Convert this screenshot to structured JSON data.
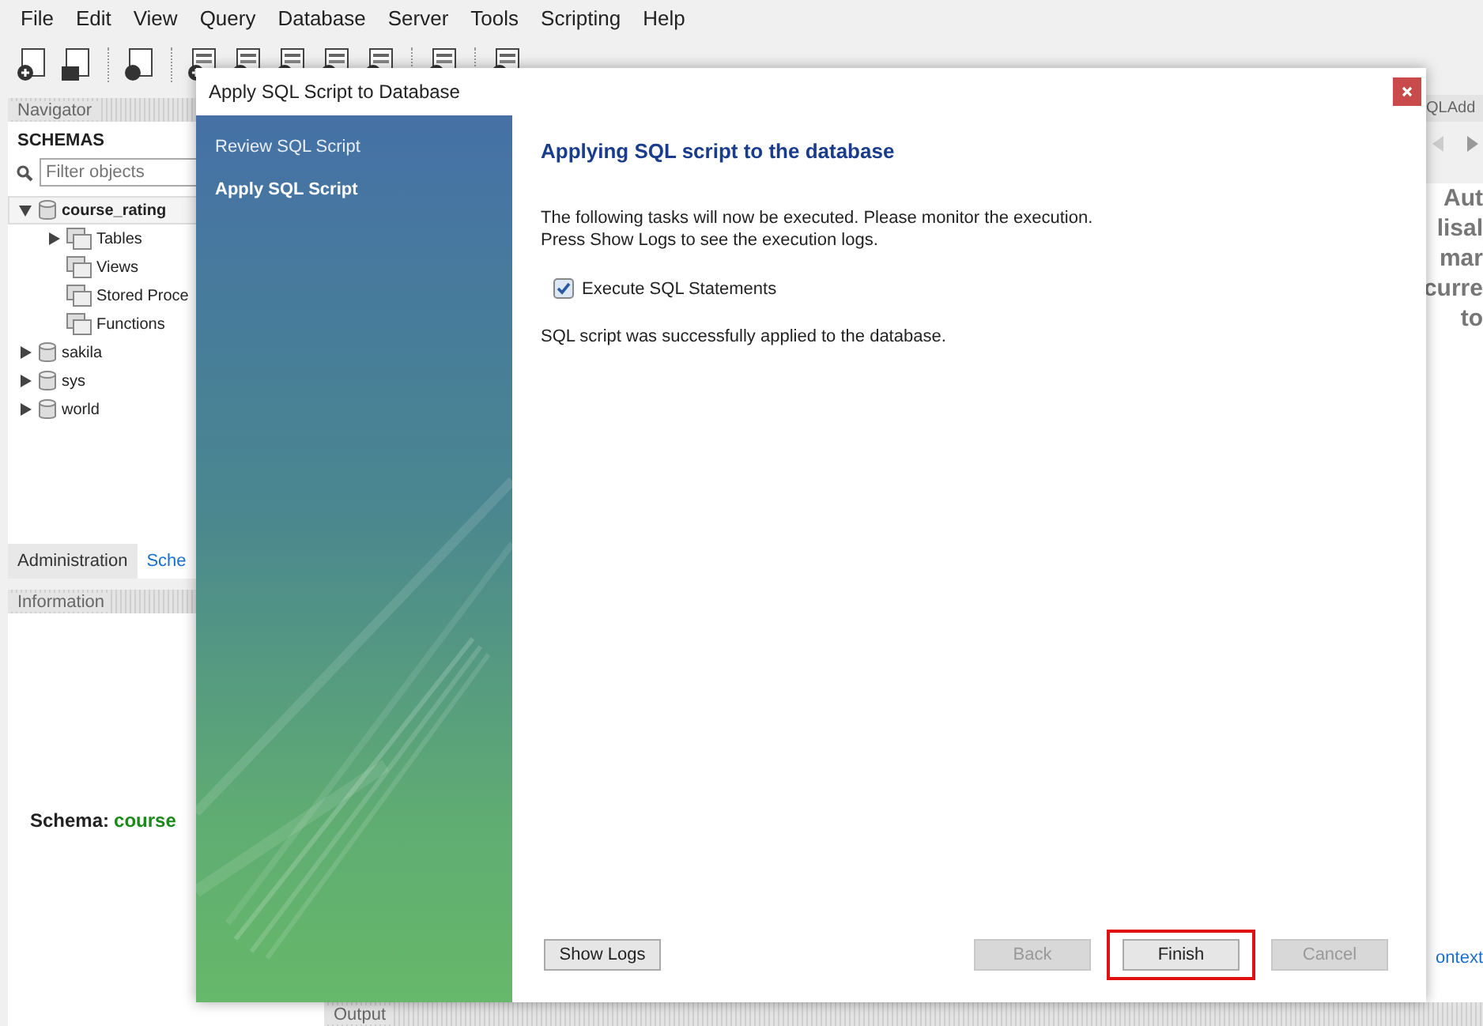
{
  "menu": [
    "File",
    "Edit",
    "View",
    "Query",
    "Database",
    "Server",
    "Tools",
    "Scripting",
    "Help"
  ],
  "navigator": {
    "title": "Navigator",
    "section": "SCHEMAS",
    "filter": {
      "placeholder": "Filter objects"
    },
    "tree": [
      {
        "label": "course_rating",
        "kind": "schema",
        "expanded": true,
        "selected": true,
        "children": [
          {
            "label": "Tables",
            "kind": "folder",
            "expanded": false,
            "selected": false
          },
          {
            "label": "Views",
            "kind": "folder",
            "selected": false
          },
          {
            "label": "Stored Proce",
            "kind": "folder",
            "selected": false
          },
          {
            "label": "Functions",
            "kind": "folder",
            "selected": false
          }
        ]
      },
      {
        "label": "sakila",
        "kind": "schema",
        "expanded": false,
        "selected": false
      },
      {
        "label": "sys",
        "kind": "schema",
        "expanded": false,
        "selected": false
      },
      {
        "label": "world",
        "kind": "schema",
        "expanded": false,
        "selected": false
      }
    ]
  },
  "bottom_tabs": [
    {
      "label": "Administration",
      "selected": true
    },
    {
      "label": "Sche",
      "selected": false
    }
  ],
  "information": {
    "title": "Information",
    "schema_label": "Schema:",
    "schema_value": "course"
  },
  "right_panel": {
    "tab": "QLAdd",
    "lines": [
      "Aut",
      "lisal",
      "mar",
      "curre",
      "to"
    ],
    "link": "ontext"
  },
  "output": {
    "title": "Output"
  },
  "dialog": {
    "title": "Apply SQL Script to Database",
    "steps": [
      {
        "label": "Review SQL Script",
        "selected": false
      },
      {
        "label": "Apply SQL Script",
        "selected": true
      }
    ],
    "heading": "Applying SQL script to the database",
    "intro": [
      "The following tasks will now be executed. Please monitor the execution.",
      "Press Show Logs to see the execution logs."
    ],
    "tasks": [
      {
        "label": "Execute SQL Statements",
        "checked": true
      }
    ],
    "message": "SQL script was successfully applied to the database.",
    "buttons": [
      {
        "label": "Show Logs",
        "disabled": false,
        "highlighted": false
      },
      {
        "label": "Back",
        "disabled": true,
        "highlighted": false
      },
      {
        "label": "Finish",
        "disabled": false,
        "highlighted": true
      },
      {
        "label": "Cancel",
        "disabled": true,
        "highlighted": false
      }
    ]
  }
}
